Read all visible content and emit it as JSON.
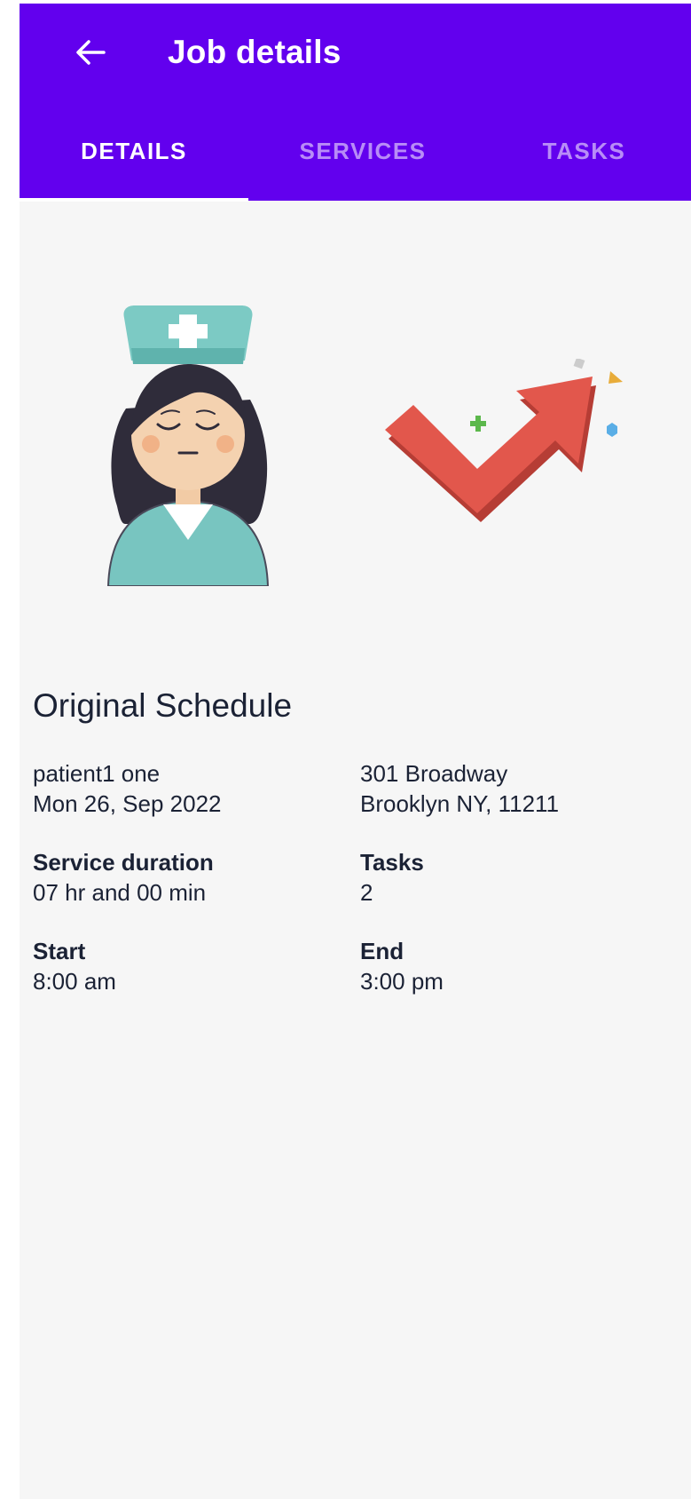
{
  "header": {
    "title": "Job details",
    "back_icon": "arrow-left-icon",
    "color": "#6200ee"
  },
  "tabs": [
    {
      "label": "DETAILS",
      "active": true
    },
    {
      "label": "SERVICES",
      "active": false
    },
    {
      "label": "TASKS",
      "active": false
    }
  ],
  "illustrations": {
    "left": "nurse-illustration",
    "right": "trend-up-arrow-illustration"
  },
  "schedule": {
    "title": "Original Schedule",
    "patient_name": "patient1 one",
    "date": "Mon 26, Sep 2022",
    "address_line1": "301 Broadway",
    "address_line2": "Brooklyn NY, 11211",
    "service_duration_label": "Service duration",
    "service_duration_value": "07 hr and 00 min",
    "tasks_label": "Tasks",
    "tasks_value": "2",
    "start_label": "Start",
    "start_value": "8:00 am",
    "end_label": "End",
    "end_value": "3:00 pm"
  }
}
